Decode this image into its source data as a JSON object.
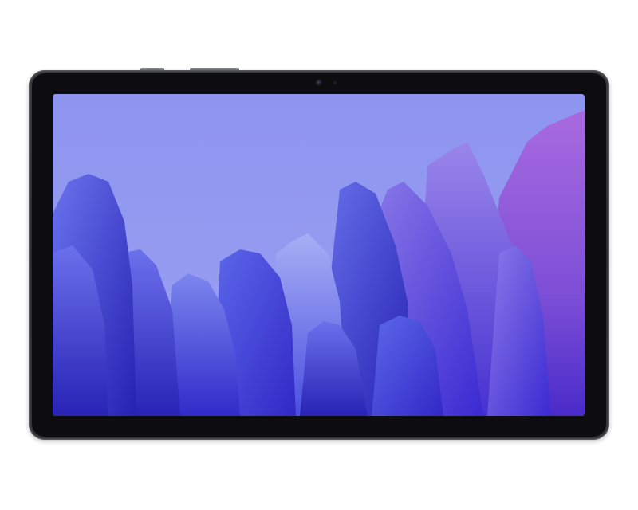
{
  "device": {
    "body_color": "#2f3034",
    "bezel_color": "#0d0d0f"
  },
  "wallpaper": {
    "sky_color": "#9198f0",
    "palette": [
      "#3b2fd6",
      "#5a55e8",
      "#7b70ea",
      "#9a6be0",
      "#b35fd2",
      "#2a20b8"
    ]
  }
}
